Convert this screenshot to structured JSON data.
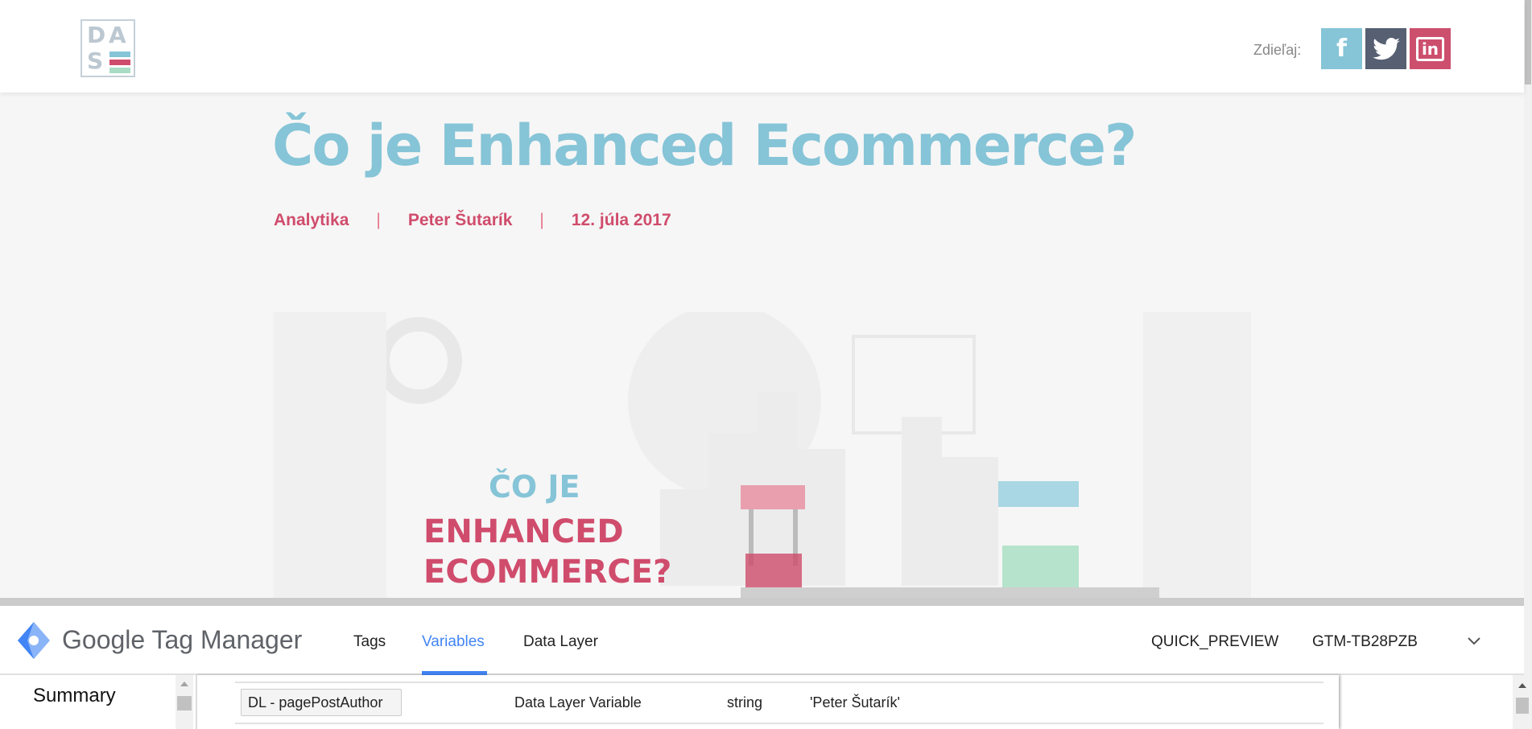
{
  "site": {
    "logo_letters": [
      "D",
      "A",
      "S"
    ],
    "share_label": "Zdieľaj:",
    "social": [
      {
        "name": "facebook",
        "glyph": "f",
        "color": "#86c4d7"
      },
      {
        "name": "twitter",
        "glyph": "🐦",
        "color": "#566072"
      },
      {
        "name": "linkedin",
        "glyph": "in",
        "color": "#cd4f6e"
      }
    ]
  },
  "article": {
    "title": "Čo je Enhanced Ecommerce?",
    "category": "Analytika",
    "author": "Peter Šutarík",
    "date": "12. júla 2017",
    "hero": {
      "line1": "ČO JE",
      "line2": "ENHANCED",
      "line3": "ECOMMERCE?"
    }
  },
  "colors": {
    "accent_blue": "#86c4d7",
    "accent_red": "#d04c6c",
    "gtm_blue": "#4285f4"
  },
  "gtm": {
    "title": "Google Tag Manager",
    "tabs": [
      {
        "label": "Tags"
      },
      {
        "label": "Variables",
        "active": true
      },
      {
        "label": "Data Layer"
      }
    ],
    "mode": "QUICK_PREVIEW",
    "container_id": "GTM-TB28PZB",
    "sidebar": {
      "summary": "Summary"
    },
    "rows": [
      {
        "name": "DL - pagePostAuthor",
        "type": "Data Layer Variable",
        "return_type": "string",
        "value": "'Peter Šutarík'"
      }
    ]
  }
}
